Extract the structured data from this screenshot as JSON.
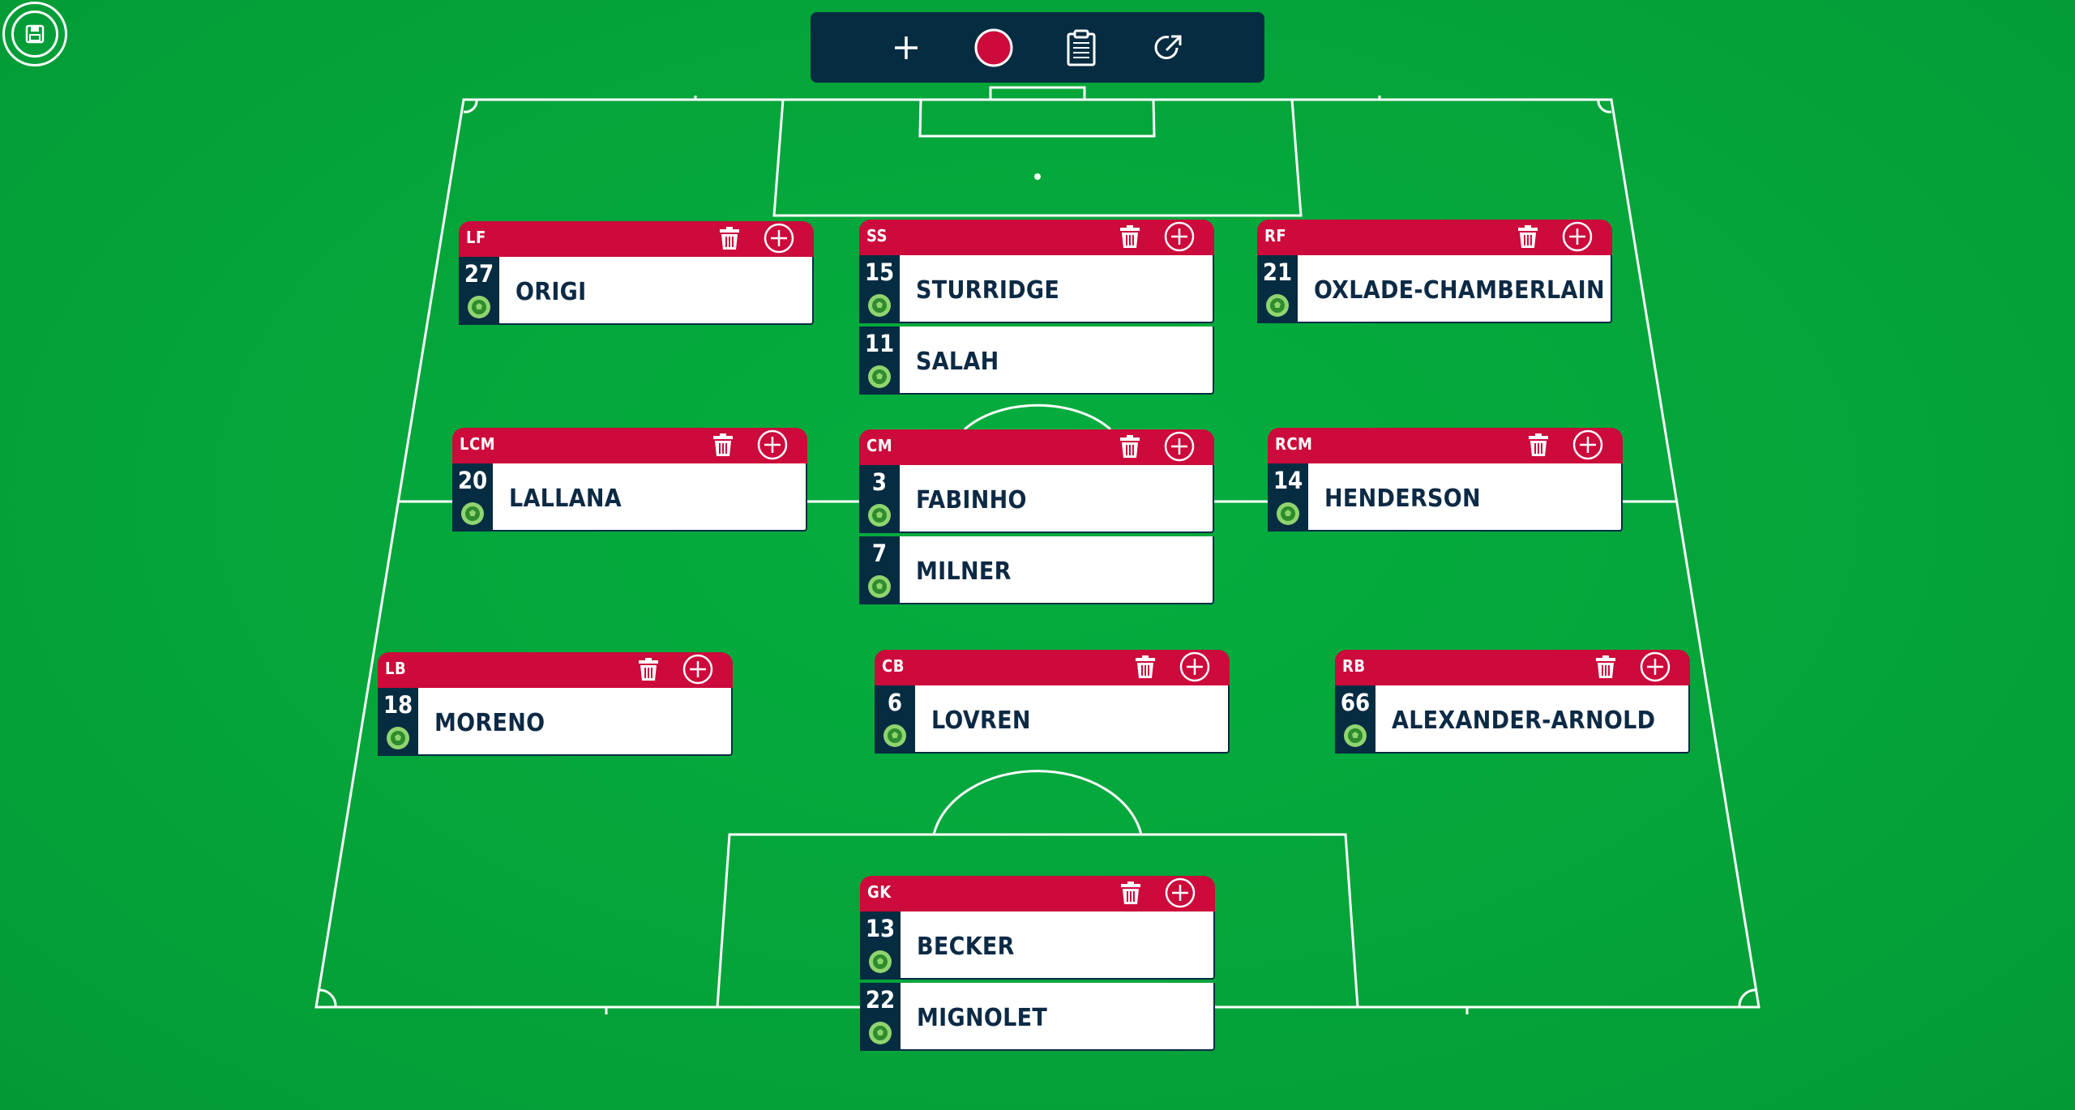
{
  "toolbar": {
    "buttons": [
      {
        "icon": "plus-icon"
      },
      {
        "icon": "kit-color-swatch",
        "color": "#cc0a3b"
      },
      {
        "icon": "clipboard-icon"
      },
      {
        "icon": "share-icon"
      }
    ]
  },
  "colors": {
    "pitch": "#05ad3e",
    "line": "#ffffff",
    "header": "#cc0a3b",
    "number_column": "#062c42",
    "toolbar": "#062c42"
  },
  "positions": {
    "lf": {
      "label": "LF",
      "players": [
        {
          "number": "27",
          "name": "ORIGI"
        }
      ]
    },
    "ss": {
      "label": "SS",
      "players": [
        {
          "number": "15",
          "name": "STURRIDGE"
        },
        {
          "number": "11",
          "name": "SALAH"
        }
      ]
    },
    "rf": {
      "label": "RF",
      "players": [
        {
          "number": "21",
          "name": "OXLADE-CHAMBERLAIN"
        }
      ]
    },
    "lcm": {
      "label": "LCM",
      "players": [
        {
          "number": "20",
          "name": "LALLANA"
        }
      ]
    },
    "cm": {
      "label": "CM",
      "players": [
        {
          "number": "3",
          "name": "FABINHO"
        },
        {
          "number": "7",
          "name": "MILNER"
        }
      ]
    },
    "rcm": {
      "label": "RCM",
      "players": [
        {
          "number": "14",
          "name": "HENDERSON"
        }
      ]
    },
    "lb": {
      "label": "LB",
      "players": [
        {
          "number": "18",
          "name": "MORENO"
        }
      ]
    },
    "cb": {
      "label": "CB",
      "players": [
        {
          "number": "6",
          "name": "LOVREN"
        }
      ]
    },
    "rb": {
      "label": "RB",
      "players": [
        {
          "number": "66",
          "name": "ALEXANDER-ARNOLD"
        }
      ]
    },
    "gk": {
      "label": "GK",
      "players": [
        {
          "number": "13",
          "name": "BECKER"
        },
        {
          "number": "22",
          "name": "MIGNOLET"
        }
      ]
    }
  }
}
